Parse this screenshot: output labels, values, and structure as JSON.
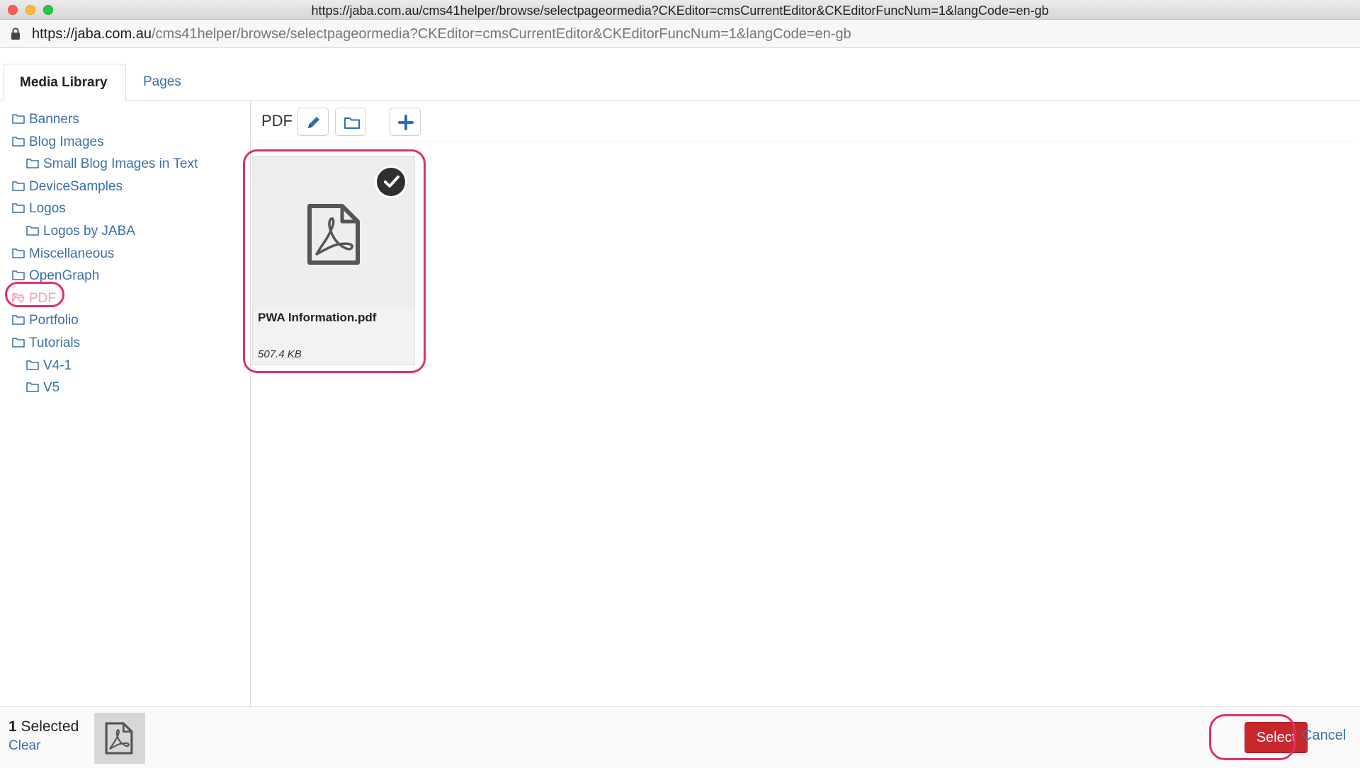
{
  "window": {
    "title": "https://jaba.com.au/cms41helper/browse/selectpageormedia?CKEditor=cmsCurrentEditor&CKEditorFuncNum=1&langCode=en-gb"
  },
  "address_bar": {
    "host": "https://jaba.com.au",
    "path": "/cms41helper/browse/selectpageormedia?CKEditor=cmsCurrentEditor&CKEditorFuncNum=1&langCode=en-gb"
  },
  "tabs": [
    {
      "label": "Media Library",
      "active": true
    },
    {
      "label": "Pages",
      "active": false
    }
  ],
  "folders": [
    {
      "label": "Banners",
      "level": 0
    },
    {
      "label": "Blog Images",
      "level": 0
    },
    {
      "label": "Small Blog Images in Text",
      "level": 1
    },
    {
      "label": "DeviceSamples",
      "level": 0
    },
    {
      "label": "Logos",
      "level": 0
    },
    {
      "label": "Logos by JABA",
      "level": 1
    },
    {
      "label": "Miscellaneous",
      "level": 0
    },
    {
      "label": "OpenGraph",
      "level": 0
    },
    {
      "label": "PDF",
      "level": 0,
      "selected": true
    },
    {
      "label": "Portfolio",
      "level": 0
    },
    {
      "label": "Tutorials",
      "level": 0
    },
    {
      "label": "V4-1",
      "level": 1
    },
    {
      "label": "V5",
      "level": 1
    }
  ],
  "toolbar": {
    "folder_title": "PDF",
    "edit_icon": "pencil-icon",
    "folder_icon": "folder-icon",
    "add_icon": "plus-icon"
  },
  "files": [
    {
      "name": "PWA Information.pdf",
      "size": "507.4 KB",
      "selected": true,
      "icon": "pdf-file-icon"
    }
  ],
  "footer": {
    "count": "1",
    "count_label": "Selected",
    "clear_label": "Clear",
    "select_label": "Select",
    "cancel_label": "Cancel"
  },
  "colors": {
    "link": "#3a6fa8",
    "select_button": "#c8282c",
    "highlight": "#e0306a"
  }
}
